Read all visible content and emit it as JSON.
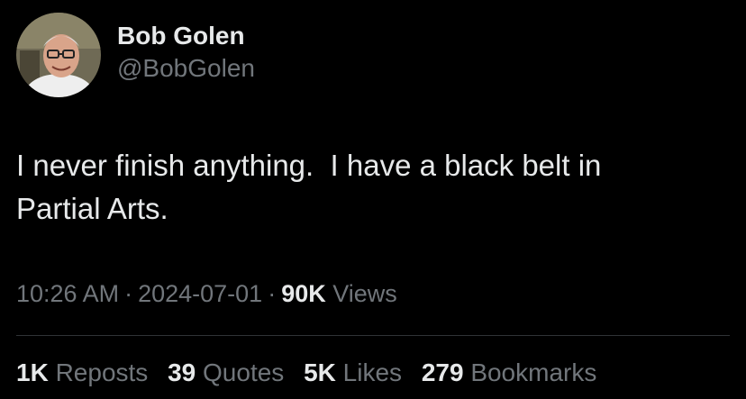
{
  "author": {
    "display_name": "Bob Golen",
    "handle": "@BobGolen",
    "avatar_icon": "profile-photo"
  },
  "tweet": {
    "text_lines": [
      "I never finish anything.  I have a black belt in",
      "Partial Arts."
    ]
  },
  "meta": {
    "time": "10:26 AM",
    "separator": "·",
    "date": "2024-07-01",
    "views_count": "90K",
    "views_label": "Views"
  },
  "stats": [
    {
      "count": "1K",
      "label": "Reposts"
    },
    {
      "count": "39",
      "label": "Quotes"
    },
    {
      "count": "5K",
      "label": "Likes"
    },
    {
      "count": "279",
      "label": "Bookmarks"
    }
  ],
  "colors": {
    "background": "#000000",
    "primary_text": "#e7e9ea",
    "secondary_text": "#71767b",
    "divider": "#2f3336"
  }
}
